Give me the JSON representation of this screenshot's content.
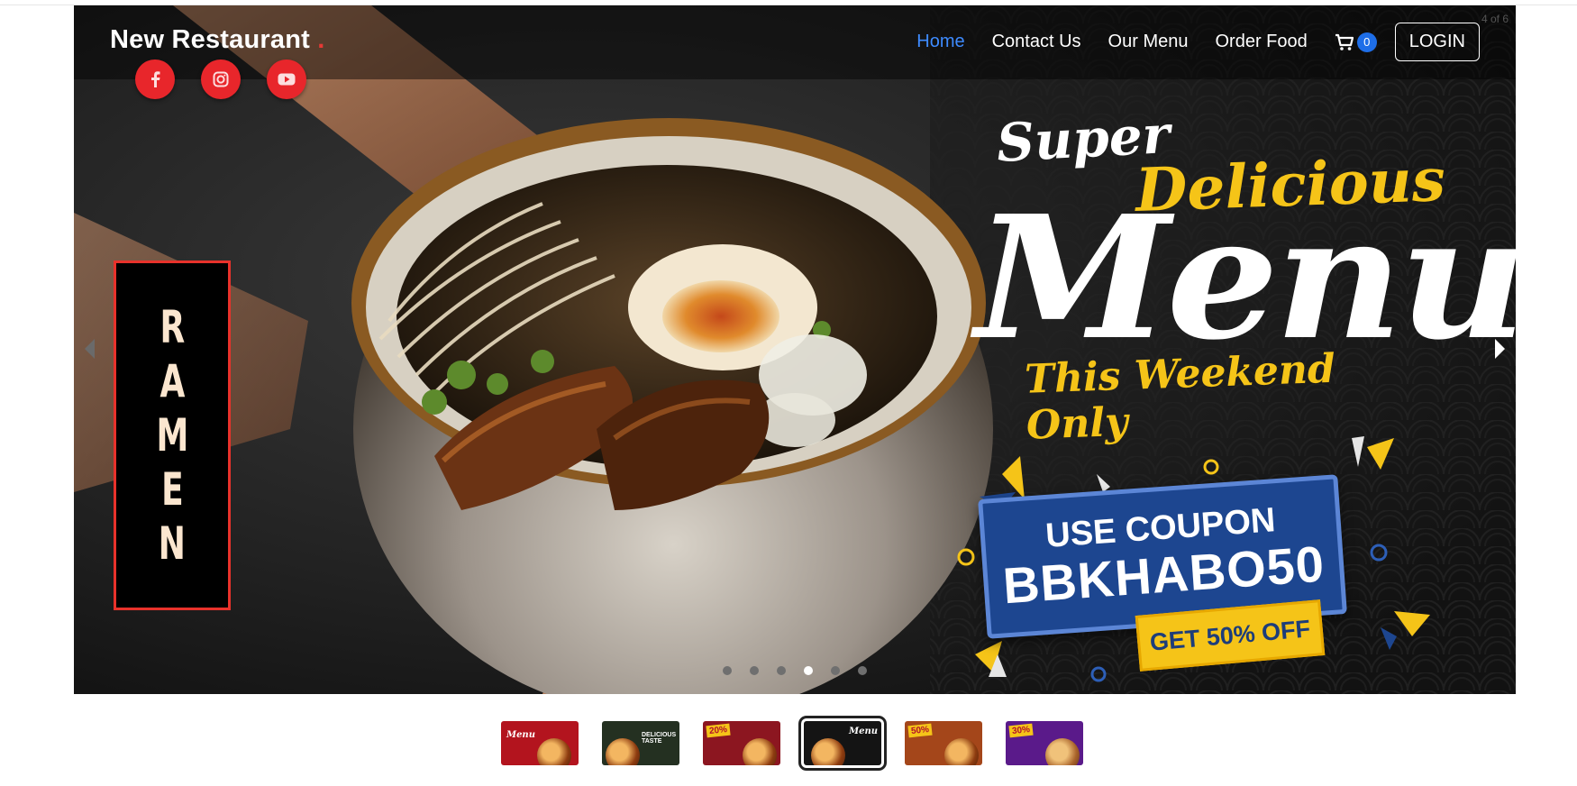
{
  "slide_counter": "4 of 6",
  "brand": {
    "name": "New Restaurant",
    "dot": "."
  },
  "nav": {
    "links": [
      {
        "label": "Home",
        "active": true
      },
      {
        "label": "Contact Us",
        "active": false
      },
      {
        "label": "Our Menu",
        "active": false
      },
      {
        "label": "Order Food",
        "active": false
      }
    ],
    "cart_count": "0",
    "login_label": "LOGIN"
  },
  "social": [
    "facebook-icon",
    "instagram-icon",
    "youtube-icon"
  ],
  "slide": {
    "sign_letters": [
      "R",
      "A",
      "M",
      "E",
      "N"
    ],
    "promo_super": "Super",
    "promo_delicious": "Delicious",
    "promo_menu": "Menu",
    "promo_weekend": "This Weekend Only",
    "coupon_line1": "USE COUPON",
    "coupon_code": "BBKHABO50",
    "offer": "GET 50% OFF"
  },
  "carousel": {
    "total": 6,
    "active_index": 4
  },
  "thumbnails": [
    {
      "label": "Menu",
      "bg": "#b3141e",
      "active": false
    },
    {
      "label": "DELICIOUS TASTE",
      "bg": "#243021",
      "active": false
    },
    {
      "label": "20%",
      "bg": "#8c1620",
      "active": false
    },
    {
      "label": "Menu",
      "bg": "#141414",
      "active": true
    },
    {
      "label": "50%",
      "bg": "#a4461a",
      "active": false
    },
    {
      "label": "30%",
      "bg": "#5a1a8a",
      "active": false
    }
  ],
  "colors": {
    "accent_red": "#e8262b",
    "nav_active": "#3e8bff",
    "promo_yellow": "#f5c418",
    "coupon_blue": "#1d4690"
  }
}
